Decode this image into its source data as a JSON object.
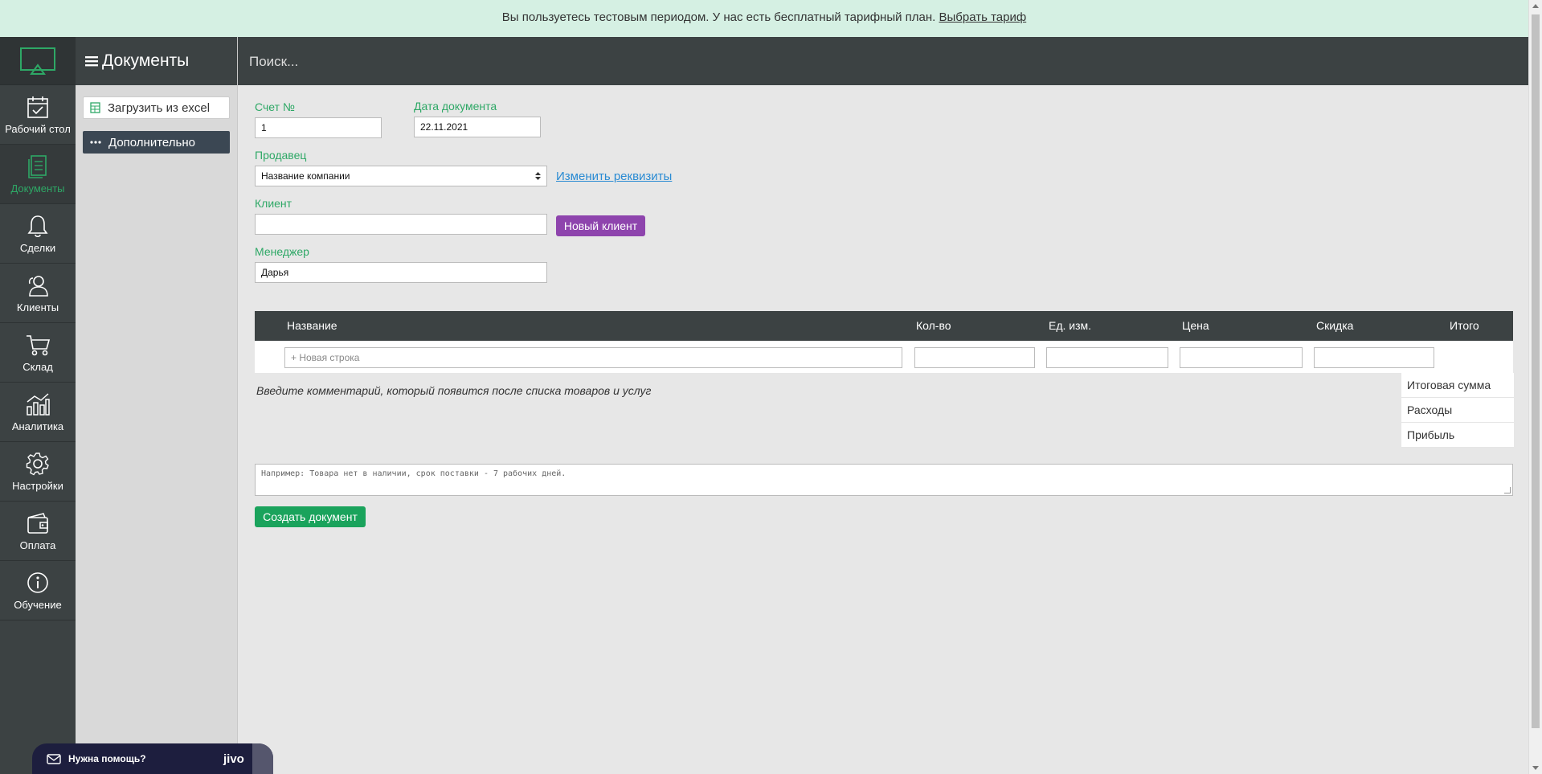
{
  "banner": {
    "text": "Вы пользуетесь тестовым периодом. У нас есть бесплатный тарифный план.",
    "link": "Выбрать тариф"
  },
  "nav": {
    "items": [
      {
        "label": "Рабочий стол",
        "icon": "calendar-check-icon"
      },
      {
        "label": "Документы",
        "icon": "documents-icon",
        "active": true
      },
      {
        "label": "Сделки",
        "icon": "bell-icon"
      },
      {
        "label": "Клиенты",
        "icon": "users-icon"
      },
      {
        "label": "Склад",
        "icon": "cart-icon"
      },
      {
        "label": "Аналитика",
        "icon": "analytics-icon"
      },
      {
        "label": "Настройки",
        "icon": "gear-icon"
      },
      {
        "label": "Оплата",
        "icon": "wallet-icon"
      },
      {
        "label": "Обучение",
        "icon": "info-icon"
      }
    ],
    "active_color": "#2ea866"
  },
  "side_panel": {
    "title": "Документы",
    "load_excel": "Загрузить из excel",
    "more": "Дополнительно"
  },
  "search": {
    "placeholder": "Поиск..."
  },
  "form": {
    "invoice_label": "Счет №",
    "invoice_value": "1",
    "date_label": "Дата документа",
    "date_value": "22.11.2021",
    "seller_label": "Продавец",
    "seller_value": "Название компании",
    "change_details": "Изменить реквизиты",
    "client_label": "Клиент",
    "client_value": "",
    "new_client": "Новый клиент",
    "manager_label": "Менеджер",
    "manager_value": "Дарья"
  },
  "table": {
    "columns": [
      "Название",
      "Кол-во",
      "Ед. изм.",
      "Цена",
      "Скидка",
      "Итого"
    ],
    "new_row_placeholder": "+ Новая строка"
  },
  "comment_hint": "Введите комментарий, который появится после списка товаров и услуг",
  "totals": {
    "total": "Итоговая сумма",
    "expenses": "Расходы",
    "profit": "Прибыль"
  },
  "comment_placeholder": "Например: Товара нет в наличии, срок поставки - 7 рабочих дней.",
  "create_button": "Создать документ",
  "jivo": {
    "help": "Нужна помощь?",
    "brand": "jivo"
  },
  "colors": {
    "accent_green": "#2ea866",
    "new_client_purple": "#8e44ad",
    "create_green": "#1aa35c",
    "dark_bar": "#3c4243",
    "banner_bg": "#d5f0e3"
  }
}
